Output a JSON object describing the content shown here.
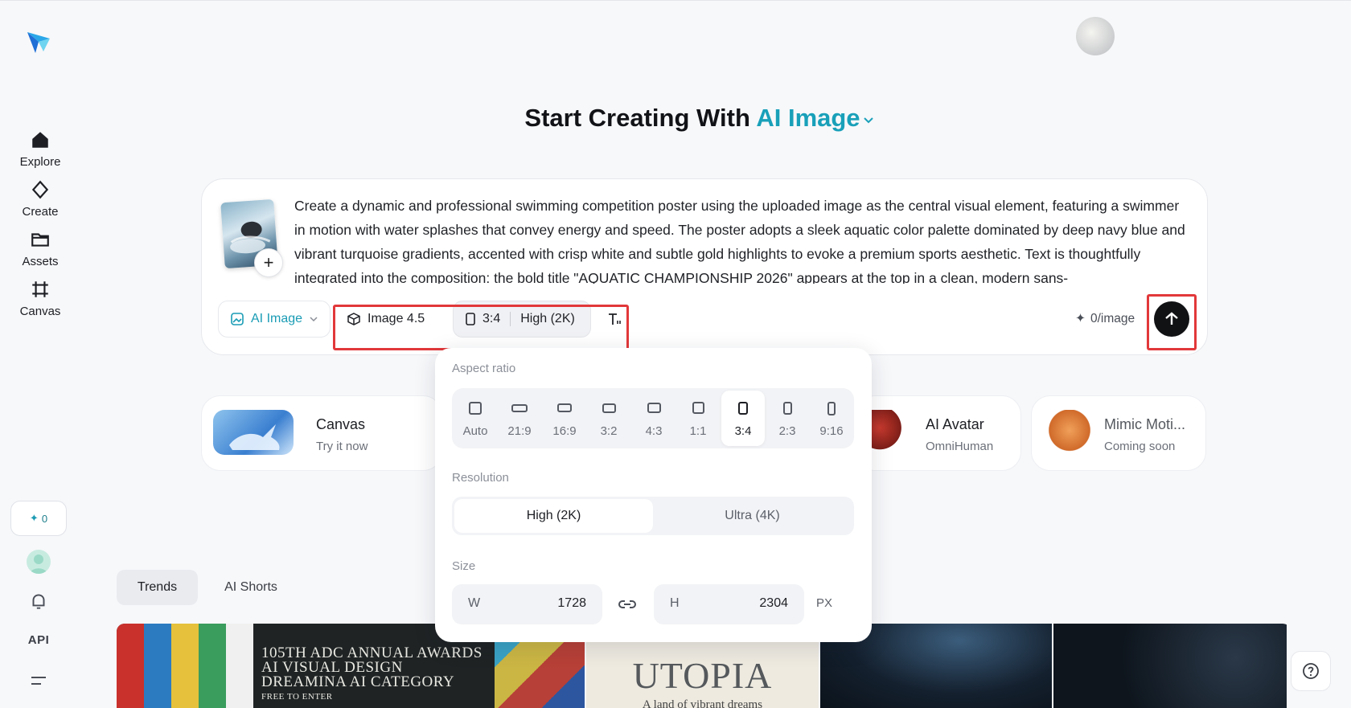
{
  "sidebar": {
    "items": [
      {
        "label": "Explore",
        "icon": "home-icon"
      },
      {
        "label": "Create",
        "icon": "sparkle-icon"
      },
      {
        "label": "Assets",
        "icon": "folder-icon"
      },
      {
        "label": "Canvas",
        "icon": "canvas-frame-icon"
      }
    ],
    "credits": "0",
    "api_label": "API"
  },
  "heading": {
    "prefix": "Start Creating With",
    "accent": "AI Image"
  },
  "prompt": {
    "text": "Create a dynamic and professional swimming competition poster using the uploaded image as the central visual element, featuring a swimmer in motion with water splashes that convey energy and speed. The poster adopts a sleek aquatic color palette dominated by deep navy blue and vibrant turquoise gradients, accented with crisp white and subtle gold highlights to evoke a premium sports aesthetic. Text is thoughtfully integrated into the composition: the bold title \"AQUATIC CHAMPIONSHIP 2026\" appears at the top in a clean, modern sans-",
    "add_label": "+"
  },
  "toolbar": {
    "mode_label": "AI Image",
    "model_label": "Image 4.5",
    "ratio_label": "3:4",
    "quality_label": "High (2K)",
    "cost_label": "0/image"
  },
  "features": [
    {
      "title": "Canvas",
      "subtitle": "Try it now"
    },
    {
      "title": "AI Avatar",
      "subtitle": "OmniHuman"
    },
    {
      "title": "Mimic Moti...",
      "subtitle": "Coming soon"
    }
  ],
  "tabs": [
    {
      "label": "Trends",
      "active": true
    },
    {
      "label": "AI Shorts",
      "active": false
    }
  ],
  "gallery": {
    "card1_lines": [
      "105TH ADC ANNUAL AWARDS",
      "AI VISUAL DESIGN",
      "DREAMINA AI CATEGORY",
      "FREE TO ENTER"
    ],
    "card2_title": "UTOPIA",
    "card2_sub": "A land of vibrant dreams"
  },
  "panel": {
    "aspect_label": "Aspect ratio",
    "ratios": [
      "Auto",
      "21:9",
      "16:9",
      "3:2",
      "4:3",
      "1:1",
      "3:4",
      "2:3",
      "9:16"
    ],
    "selected_ratio": "3:4",
    "resolution_label": "Resolution",
    "resolutions": [
      "High (2K)",
      "Ultra (4K)"
    ],
    "selected_resolution": "High (2K)",
    "size_label": "Size",
    "width_key": "W",
    "width_value": "1728",
    "height_key": "H",
    "height_value": "2304",
    "unit": "PX"
  },
  "colors": {
    "accent": "#19a0b9",
    "highlight_box": "#e2383a"
  }
}
